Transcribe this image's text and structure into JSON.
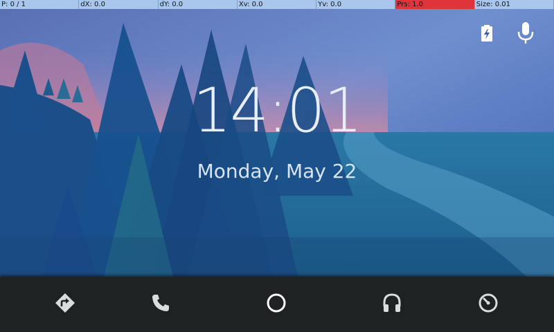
{
  "debug_bar": {
    "pointer": "P: 0 / 1",
    "dx": "dX: 0.0",
    "dy": "dY: 0.0",
    "xv": "Xv: 0.0",
    "yv": "Yv: 0.0",
    "prs": "Prs: 1.0",
    "size": "Size: 0.01"
  },
  "lock_screen": {
    "time": "14:01",
    "date": "Monday, May 22"
  },
  "status_icons": [
    "battery-charging-icon",
    "microphone-icon"
  ],
  "nav_bar": {
    "buttons": [
      "navigation-icon",
      "phone-icon",
      "home-icon",
      "headphones-icon",
      "speedometer-icon"
    ]
  },
  "colors": {
    "debug_bar": "#a9c7ec",
    "pressure_highlight": "#e0343b",
    "nav_background": "#1f2223",
    "icon": "#d9dde0",
    "sky_pink": "#d7839f",
    "lake": "#1f6e98"
  }
}
